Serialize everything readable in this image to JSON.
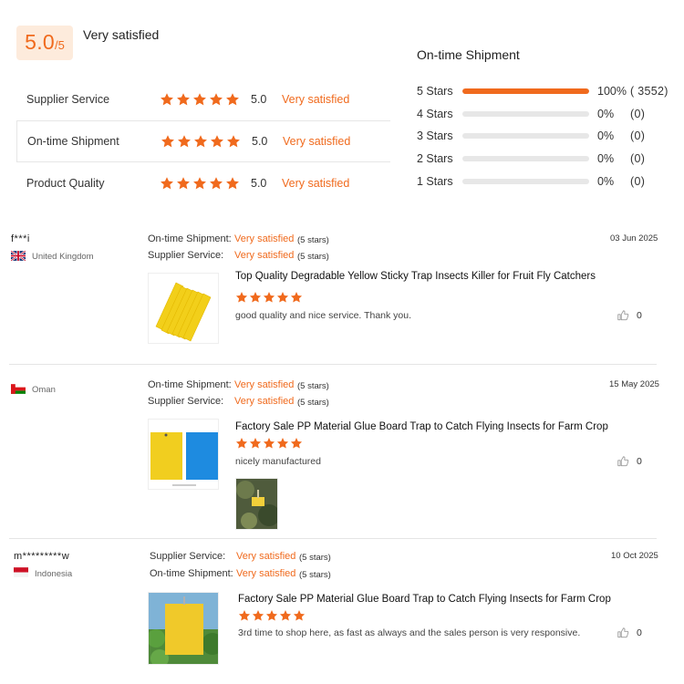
{
  "summary": {
    "score": "5.0",
    "out_of": "/5",
    "label": "Very satisfied"
  },
  "ratings": [
    {
      "label": "Supplier Service",
      "score": "5.0",
      "text": "Very satisfied"
    },
    {
      "label": "On-time Shipment",
      "score": "5.0",
      "text": "Very satisfied"
    },
    {
      "label": "Product Quality",
      "score": "5.0",
      "text": "Very satisfied"
    }
  ],
  "distribution": {
    "title": "On-time Shipment",
    "rows": [
      {
        "label": "5 Stars",
        "pct": "100%",
        "count": "( 3552)",
        "fill": 1.0
      },
      {
        "label": "4 Stars",
        "pct": "0%",
        "count": "(0)",
        "fill": 0
      },
      {
        "label": "3 Stars",
        "pct": "0%",
        "count": "(0)",
        "fill": 0
      },
      {
        "label": "2 Stars",
        "pct": "0%",
        "count": "(0)",
        "fill": 0
      },
      {
        "label": "1 Stars",
        "pct": "0%",
        "count": "(0)",
        "fill": 0
      }
    ]
  },
  "reviews": [
    {
      "name": "f***i",
      "country": "United Kingdom",
      "flag": "flag-uk",
      "meta": [
        {
          "label": "On-time Shipment:",
          "value": "Very satisfied",
          "count": "(5 stars)"
        },
        {
          "label": "Supplier Service:",
          "value": "Very satisfied",
          "count": "(5 stars)"
        }
      ],
      "date": "03 Jun 2025",
      "product": "Top Quality Degradable Yellow Sticky Trap Insects Killer for Fruit Fly Catchers",
      "text": "good quality and nice service. Thank you.",
      "likes": "0"
    },
    {
      "name": "",
      "country": "Oman",
      "flag": "flag-oman",
      "meta": [
        {
          "label": "On-time Shipment:",
          "value": "Very satisfied",
          "count": "(5 stars)"
        },
        {
          "label": "Supplier Service:",
          "value": "Very satisfied",
          "count": "(5 stars)"
        }
      ],
      "date": "15 May 2025",
      "product": "Factory Sale PP Material Glue Board Trap to Catch Flying Insects for Farm Crop",
      "text": "nicely manufactured",
      "likes": "0"
    },
    {
      "name": "m*********w",
      "country": "Indonesia",
      "flag": "flag-indonesia",
      "meta": [
        {
          "label": "Supplier Service:",
          "value": "Very satisfied",
          "count": "(5 stars)"
        },
        {
          "label": "On-time Shipment:",
          "value": "Very satisfied",
          "count": "(5 stars)"
        }
      ],
      "date": "10 Oct 2025",
      "product": "Factory Sale PP Material Glue Board Trap to Catch Flying Insects for Farm Crop",
      "text": "3rd time to shop here, as fast as always and the sales person is very responsive.",
      "likes": "0"
    }
  ],
  "colors": {
    "accent": "#f06a1d",
    "score_bg": "#fdebdc",
    "bar_bg": "#e7e7e7"
  }
}
